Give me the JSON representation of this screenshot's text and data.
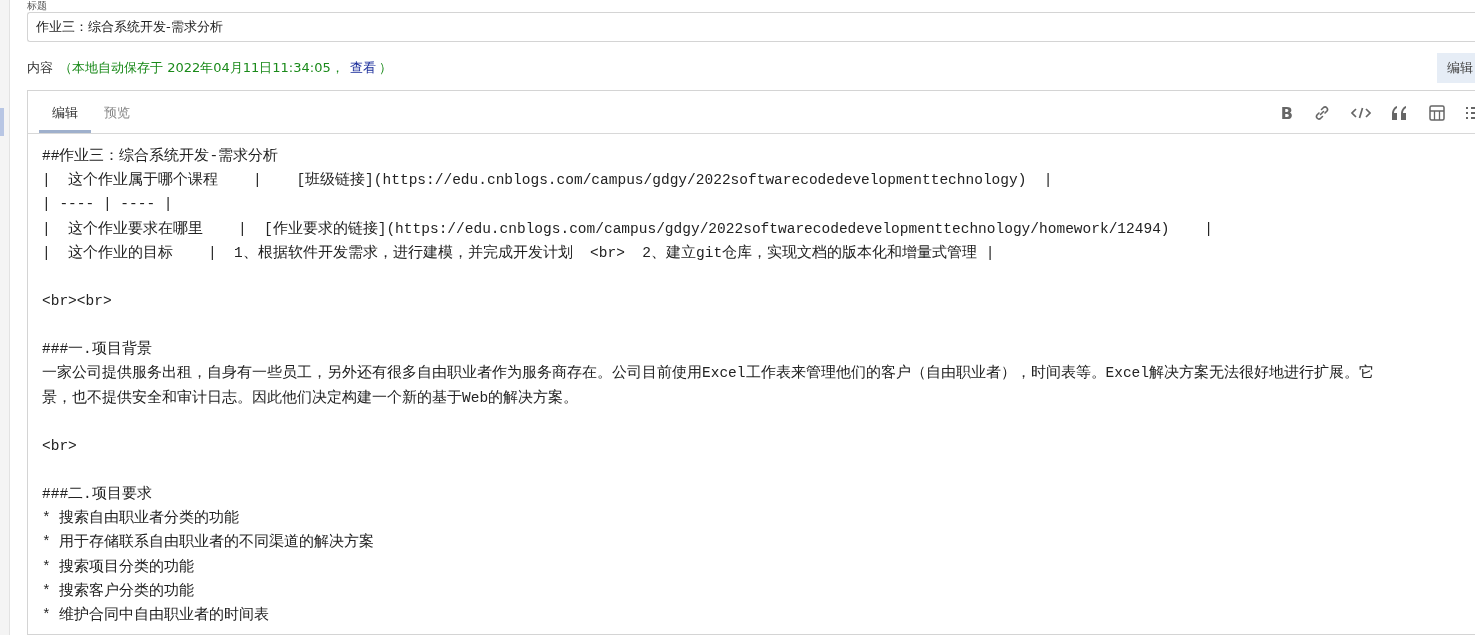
{
  "title_field": {
    "label": "标题",
    "value": "作业三：综合系统开发-需求分析"
  },
  "content_header": {
    "label": "内容",
    "autosave": "（本地自动保存于 2022年04月11日11:34:05，",
    "view_link": "查看",
    "autosave_end": "）",
    "editor_button": "编辑"
  },
  "editor": {
    "tabs": [
      {
        "label": "编辑",
        "selected": true
      },
      {
        "label": "预览",
        "selected": false
      }
    ],
    "toolbar": [
      {
        "kind": "bold",
        "label": "B"
      },
      {
        "kind": "link"
      },
      {
        "kind": "code"
      },
      {
        "kind": "quote"
      },
      {
        "kind": "table"
      },
      {
        "kind": "list"
      }
    ],
    "blocks": [
      [
        "##作业三：综合系统开发-需求分析",
        "|  这个作业属于哪个课程    |    [班级链接](https://edu.cnblogs.com/campus/gdgy/2022softwarecodedevelopmenttechnology)  |",
        "| ---- | ---- |",
        "|  这个作业要求在哪里    |  [作业要求的链接](https://edu.cnblogs.com/campus/gdgy/2022softwarecodedevelopmenttechnology/homework/12494)    |",
        "|  这个作业的目标    |  1、根据软件开发需求，进行建模，并完成开发计划  <br>  2、建立git仓库，实现文档的版本化和增量式管理 |"
      ],
      [
        "<br><br>"
      ],
      [
        "###一.项目背景",
        "一家公司提供服务出租，自身有一些员工，另外还有很多自由职业者作为服务商存在。公司目前使用Excel工作表来管理他们的客户（自由职业者），时间表等。Excel解决方案无法很好地进行扩展。它",
        "景，也不提供安全和审计日志。因此他们决定构建一个新的基于Web的解决方案。"
      ],
      [
        "<br>"
      ],
      [
        "###二.项目要求",
        "* 搜索自由职业者分类的功能",
        "* 用于存储联系自由职业者的不同渠道的解决方案",
        "* 搜索项目分类的功能",
        "* 搜索客户分类的功能",
        "* 维护合同中自由职业者的时间表"
      ]
    ]
  }
}
